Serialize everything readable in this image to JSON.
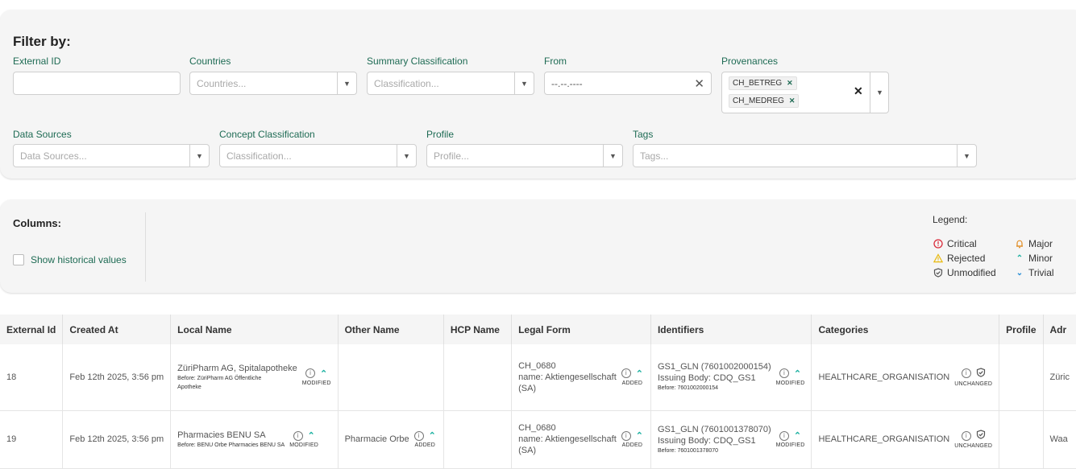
{
  "filter": {
    "title": "Filter by:",
    "external_id": {
      "label": "External ID",
      "value": ""
    },
    "countries": {
      "label": "Countries",
      "placeholder": "Countries..."
    },
    "summary_classification": {
      "label": "Summary Classification",
      "placeholder": "Classification..."
    },
    "from": {
      "label": "From",
      "value": "--.--.----"
    },
    "provenances": {
      "label": "Provenances",
      "chips": [
        "CH_BETREG",
        "CH_MEDREG"
      ]
    },
    "data_sources": {
      "label": "Data Sources",
      "placeholder": "Data Sources..."
    },
    "concept_classification": {
      "label": "Concept Classification",
      "placeholder": "Classification..."
    },
    "profile": {
      "label": "Profile",
      "placeholder": "Profile..."
    },
    "tags": {
      "label": "Tags",
      "placeholder": "Tags..."
    }
  },
  "columns": {
    "title": "Columns:",
    "show_historical": "Show historical values",
    "show_historical_checked": false
  },
  "legend": {
    "title": "Legend:",
    "items": {
      "critical": "Critical",
      "major": "Major",
      "rejected": "Rejected",
      "minor": "Minor",
      "unmodified": "Unmodified",
      "trivial": "Trivial"
    },
    "colors": {
      "critical": "#d92b3a",
      "major": "#e08a1e",
      "rejected": "#e8b90e",
      "minor": "#1ab0a0",
      "trivial": "#2a8fd6"
    }
  },
  "table": {
    "headers": [
      "External Id",
      "Created At",
      "Local Name",
      "Other Name",
      "HCP Name",
      "Legal Form",
      "Identifiers",
      "Categories",
      "Profile",
      "Adr"
    ],
    "rows": [
      {
        "external_id": "18",
        "created_at": "Feb 12th 2025, 3:56 pm",
        "local_name": "ZüriPharm AG, Spitalapotheke",
        "local_name_before_1": "Before: ZüriPharm AG Öffentliche",
        "local_name_before_2": "Apotheke",
        "local_name_status": "MODIFIED",
        "other_name": "",
        "other_name_status": "",
        "legal_form_1": "CH_0680",
        "legal_form_2": "name: Aktiengesellschaft",
        "legal_form_3": "(SA)",
        "legal_form_status": "ADDED",
        "identifier_1": "GS1_GLN (7601002000154)",
        "identifier_2": "Issuing Body: CDQ_GS1",
        "identifier_before": "Before: 7601002000154",
        "identifier_status": "MODIFIED",
        "category": "HEALTHCARE_ORGANISATION",
        "category_status": "UNCHANGED",
        "address": "Züric"
      },
      {
        "external_id": "19",
        "created_at": "Feb 12th 2025, 3:56 pm",
        "local_name": "Pharmacies BENU SA",
        "local_name_before_1": "Before: BENU Orbe Pharmacies BENU SA",
        "local_name_before_2": "",
        "local_name_status": "MODIFIED",
        "other_name": "Pharmacie Orbe",
        "other_name_status": "ADDED",
        "legal_form_1": "CH_0680",
        "legal_form_2": "name: Aktiengesellschaft",
        "legal_form_3": "(SA)",
        "legal_form_status": "ADDED",
        "identifier_1": "GS1_GLN (7601001378070)",
        "identifier_2": "Issuing Body: CDQ_GS1",
        "identifier_before": "Before: 7601001378070",
        "identifier_status": "MODIFIED",
        "category": "HEALTHCARE_ORGANISATION",
        "category_status": "UNCHANGED",
        "address": "Waa"
      }
    ]
  }
}
